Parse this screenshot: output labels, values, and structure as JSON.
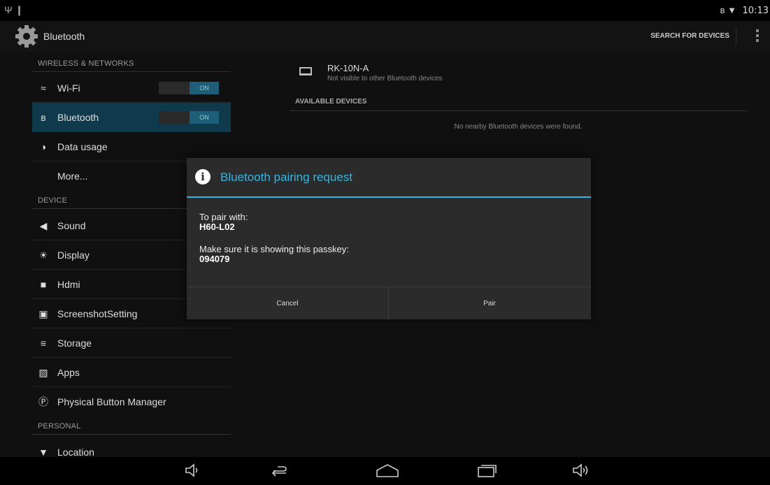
{
  "status_bar": {
    "left_icons": "Ψ ❙",
    "right_icons": "ʙ ▼",
    "time": "10:13"
  },
  "action_bar": {
    "title": "Bluetooth",
    "search_button": "SEARCH FOR DEVICES",
    "overflow_icon": "overflow-menu-icon"
  },
  "settings": {
    "headers": [
      "WIRELESS & NETWORKS",
      "DEVICE",
      "PERSONAL"
    ],
    "items": [
      {
        "label": "Wi-Fi",
        "icon": "wifi-icon",
        "glyph": "≈",
        "toggle": "ON"
      },
      {
        "label": "Bluetooth",
        "icon": "bluetooth-icon",
        "glyph": "ʙ",
        "toggle": "ON",
        "selected": true
      },
      {
        "label": "Data usage",
        "icon": "data-usage-icon",
        "glyph": "◑"
      },
      {
        "label": "More..."
      },
      {
        "label": "Sound",
        "icon": "sound-icon",
        "glyph": "◀"
      },
      {
        "label": "Display",
        "icon": "display-icon",
        "glyph": "☀"
      },
      {
        "label": "Hdmi",
        "icon": "hdmi-icon",
        "glyph": "■"
      },
      {
        "label": "ScreenshotSetting",
        "icon": "camera-icon",
        "glyph": "▣"
      },
      {
        "label": "Storage",
        "icon": "storage-icon",
        "glyph": "≡"
      },
      {
        "label": "Apps",
        "icon": "apps-icon",
        "glyph": "▨"
      },
      {
        "label": "Physical Button Manager",
        "icon": "physical-button-icon",
        "glyph": "Ⓟ"
      },
      {
        "label": "Location",
        "icon": "location-icon",
        "glyph": "▼"
      }
    ]
  },
  "bluetooth_panel": {
    "device_name": "RK-10N-A",
    "device_subtitle": "Not visible to other Bluetooth devices",
    "available_header": "AVAILABLE DEVICES",
    "no_devices_message": "No nearby Bluetooth devices were found."
  },
  "dialog": {
    "title": "Bluetooth pairing request",
    "pair_with_label": "To pair with:",
    "device": "H60-L02",
    "passkey_label": "Make sure it is showing this passkey:",
    "passkey": "094079",
    "cancel_label": "Cancel",
    "pair_label": "Pair"
  },
  "nav_bar": {
    "volume_down": "◁",
    "back": "↩",
    "home": "⌂",
    "recents": "▭",
    "volume_up": "◁"
  },
  "colors": {
    "accent": "#33b5e5",
    "selected_row": "#0e3a4c",
    "toggle_on": "#1f5e79"
  }
}
